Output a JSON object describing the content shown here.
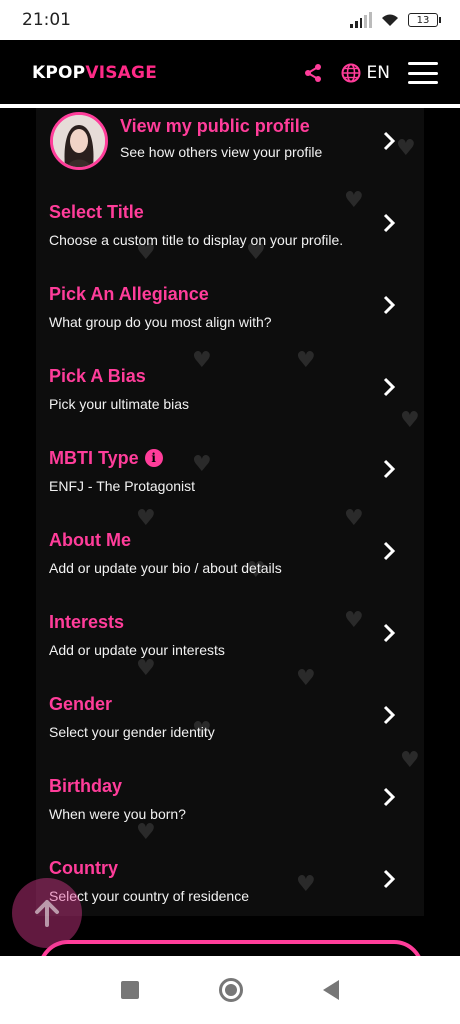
{
  "status_bar": {
    "time": "21:01",
    "battery": "13",
    "icons": [
      "signal-icon",
      "wifi-icon",
      "battery-icon"
    ]
  },
  "header": {
    "logo_part1": "KPOP",
    "logo_part2": "VISAGE",
    "language": "EN",
    "icons": [
      "share-icon",
      "globe-icon",
      "hamburger-menu-icon"
    ]
  },
  "profile": {
    "title": "View my public profile",
    "subtitle": "See how others view your profile"
  },
  "items": [
    {
      "title": "Select Title",
      "subtitle": "Choose a custom title to display on your profile."
    },
    {
      "title": "Pick An Allegiance",
      "subtitle": "What group do you most align with?"
    },
    {
      "title": "Pick A Bias",
      "subtitle": "Pick your ultimate bias"
    },
    {
      "title": "MBTI Type",
      "subtitle": "ENFJ - The Protagonist"
    },
    {
      "title": "About Me",
      "subtitle": "Add or update your bio / about details"
    },
    {
      "title": "Interests",
      "subtitle": "Add or update your interests"
    },
    {
      "title": "Gender",
      "subtitle": "Select your gender identity"
    },
    {
      "title": "Birthday",
      "subtitle": "When were you born?"
    },
    {
      "title": "Country",
      "subtitle": "Select your country of residence"
    }
  ],
  "colors": {
    "accent": "#ff3d9a",
    "background": "#000000",
    "panel": "#0d0d0d"
  }
}
